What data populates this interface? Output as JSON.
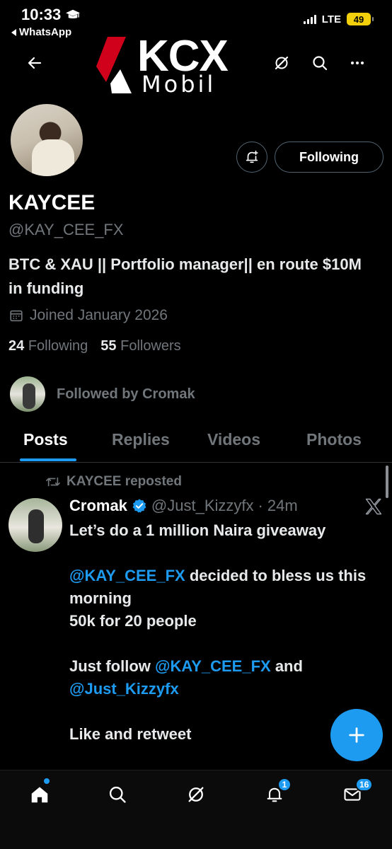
{
  "status_bar": {
    "time": "10:33",
    "back_app": "WhatsApp",
    "network": "LTE",
    "battery": "49"
  },
  "header": {
    "logo_main": "KCX",
    "logo_sub": "Mobil",
    "accent_color": "#d0021b"
  },
  "profile": {
    "display_name": "KAYCEE",
    "handle": "@KAY_CEE_FX",
    "bio": "BTC & XAU || Portfolio manager|| en route $10M in funding",
    "joined": "Joined January 2026",
    "following_count": "24",
    "following_label": "Following",
    "followers_count": "55",
    "followers_label": "Followers",
    "followed_by": "Followed by Cromak",
    "follow_button": "Following"
  },
  "tabs": [
    {
      "label": "Posts",
      "active": true
    },
    {
      "label": "Replies",
      "active": false
    },
    {
      "label": "Videos",
      "active": false
    },
    {
      "label": "Photos",
      "active": false
    }
  ],
  "post": {
    "repost_label": "KAYCEE reposted",
    "author_name": "Cromak",
    "author_handle": "@Just_Kizzyfx",
    "separator": "·",
    "time_ago": "24m",
    "line1": "Let’s do a 1 million Naira giveaway",
    "mention1": "@KAY_CEE_FX",
    "line2": " decided to bless us this morning",
    "line3": "50k for 20 people",
    "line4_prefix": "Just follow ",
    "mention2": "@KAY_CEE_FX",
    "line4_suffix": " and",
    "mention3": "@Just_Kizzyfx",
    "line5": "Like and retweet"
  },
  "bottom_nav": {
    "notifications_badge": "1",
    "messages_badge": "16"
  },
  "colors": {
    "accent": "#1d9bf0",
    "muted": "#71767b",
    "background": "#000000"
  }
}
